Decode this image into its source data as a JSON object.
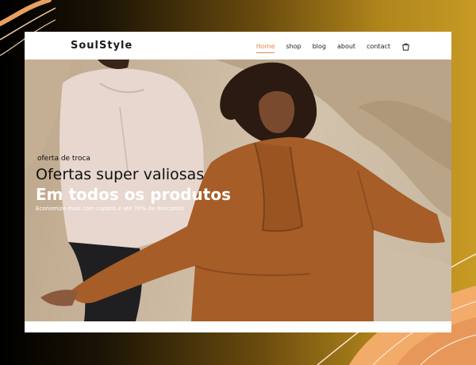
{
  "header": {
    "logo": "SoulStyle",
    "nav": [
      "Home",
      "shop",
      "blog",
      "about",
      "contact"
    ],
    "cart_icon": "shopping-bag-icon"
  },
  "hero": {
    "eyebrow": "oferta de troca",
    "headline": "Ofertas super valiosas",
    "headline2": "Em todos os produtos",
    "subtext": "Economize mais com cupons e até 70% de desconto!"
  },
  "colors": {
    "accent": "#e8834e",
    "sweatshirt": "#a65d28",
    "background_gold": "#c79a24"
  }
}
